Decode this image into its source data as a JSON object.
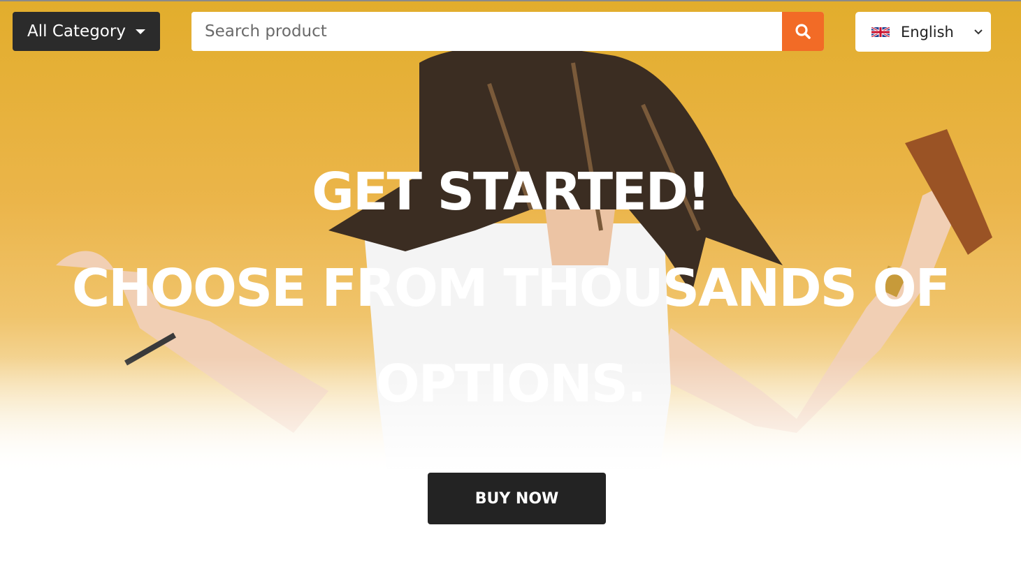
{
  "header": {
    "category_label": "All Category",
    "search_placeholder": "Search product",
    "search_value": "",
    "language_label": "English"
  },
  "hero": {
    "headline_line1": "GET STARTED!",
    "headline_line2": "CHOOSE FROM THOUSANDS OF",
    "headline_line3": "OPTIONS.",
    "cta_label": "BUY NOW"
  },
  "icons": {
    "category_caret": "caret-down-icon",
    "search": "search-icon",
    "flag": "uk-flag-icon",
    "language_chevron": "chevron-down-icon"
  },
  "colors": {
    "accent": "#f26b26",
    "dark": "#2b2b2b",
    "hero_yellow": "#e8b23c"
  }
}
